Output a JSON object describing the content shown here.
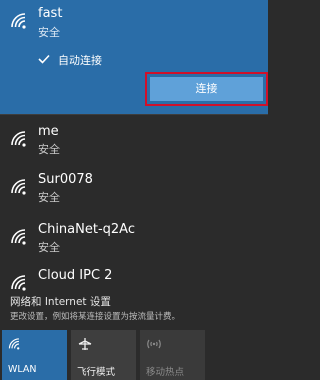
{
  "selected_network": {
    "name": "fast",
    "status": "安全",
    "auto_connect_label": "自动连接",
    "auto_connect_checked": true,
    "connect_button": "连接"
  },
  "networks": [
    {
      "name": "me",
      "status": "安全"
    },
    {
      "name": "Sur0078",
      "status": "安全"
    },
    {
      "name": "ChinaNet-q2Ac",
      "status": "安全"
    },
    {
      "name": "Cloud IPC 2",
      "status": ""
    }
  ],
  "settings": {
    "link": "网络和 Internet 设置",
    "description": "更改设置，例如将某连接设置为按流量计费。"
  },
  "quick_actions": [
    {
      "label": "WLAN",
      "state": "active",
      "icon": "wifi-icon"
    },
    {
      "label": "飞行模式",
      "state": "normal",
      "icon": "airplane-icon"
    },
    {
      "label": "移动热点",
      "state": "disabled",
      "icon": "hotspot-icon"
    }
  ],
  "colors": {
    "panel_bg": "#2b2b2b",
    "selected_bg": "#2a6da8",
    "connect_button_bg": "#5fa1d9",
    "highlight_border": "#d0102a"
  }
}
